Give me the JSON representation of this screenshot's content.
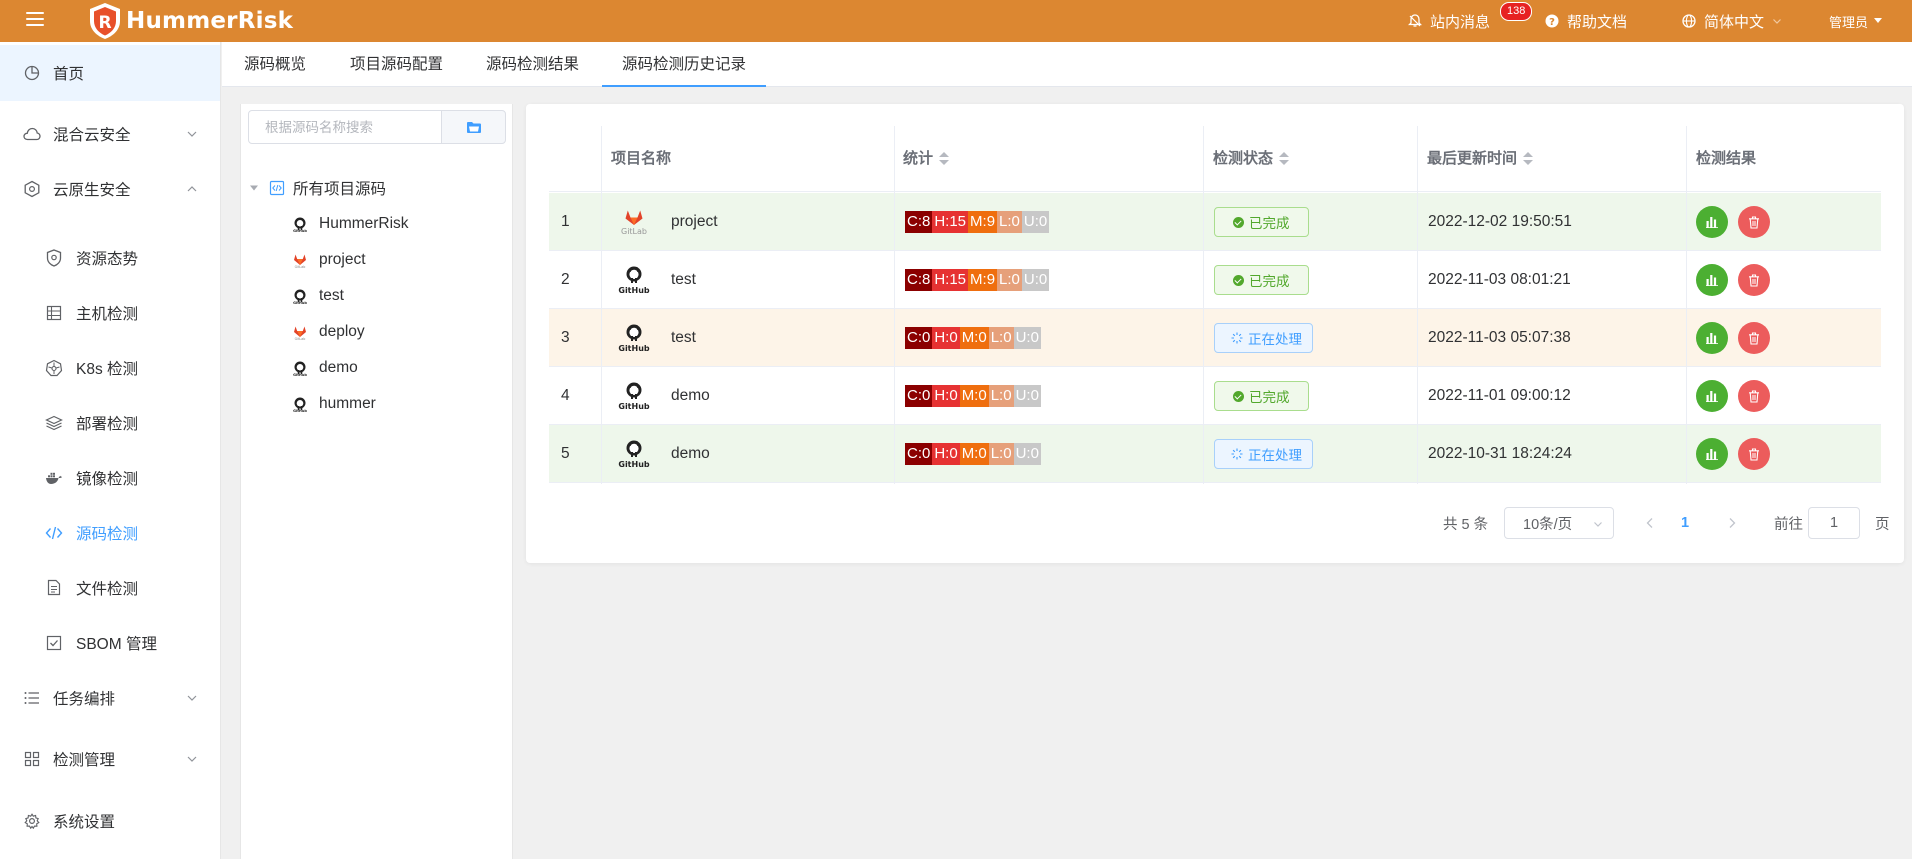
{
  "app": {
    "name": "HummerRisk",
    "brand_color": "#dc8731",
    "accent_color": "#409eff"
  },
  "header": {
    "messages_label": "站内消息",
    "messages_count": "138",
    "help_label": "帮助文档",
    "language_label": "简体中文",
    "user_label": "管理员"
  },
  "sidebar": {
    "home": "首页",
    "hybrid_cloud": "混合云安全",
    "cloud_native": "云原生安全",
    "sub": {
      "resource_posture": "资源态势",
      "host_check": "主机检测",
      "k8s_check": "K8s 检测",
      "deploy_check": "部署检测",
      "image_check": "镜像检测",
      "code_check": "源码检测",
      "file_check": "文件检测",
      "sbom": "SBOM 管理"
    },
    "task_orchestration": "任务编排",
    "check_management": "检测管理",
    "system_settings": "系统设置"
  },
  "tabs": [
    "源码概览",
    "项目源码配置",
    "源码检测结果",
    "源码检测历史记录"
  ],
  "tree": {
    "search_placeholder": "根据源码名称搜索",
    "root_label": "所有项目源码",
    "nodes": [
      {
        "label": "HummerRisk",
        "icon": "github-icon"
      },
      {
        "label": "project",
        "icon": "gitlab-icon"
      },
      {
        "label": "test",
        "icon": "github-icon"
      },
      {
        "label": "deploy",
        "icon": "gitlab-icon"
      },
      {
        "label": "demo",
        "icon": "github-icon"
      },
      {
        "label": "hummer",
        "icon": "github-icon"
      }
    ]
  },
  "table": {
    "headers": {
      "name": "项目名称",
      "stats": "统计",
      "status": "检测状态",
      "updated": "最后更新时间",
      "result": "检测结果"
    },
    "rows": [
      {
        "index": "1",
        "source": "GitLab",
        "name": "project",
        "c": "C:8",
        "h": "H:15",
        "m": "M:9",
        "l": "L:0",
        "u": "U:0",
        "status": "已完成",
        "updated": "2022-12-02 19:50:51"
      },
      {
        "index": "2",
        "source": "GitHub",
        "name": "test",
        "c": "C:8",
        "h": "H:15",
        "m": "M:9",
        "l": "L:0",
        "u": "U:0",
        "status": "已完成",
        "updated": "2022-11-03 08:01:21"
      },
      {
        "index": "3",
        "source": "GitHub",
        "name": "test",
        "c": "C:0",
        "h": "H:0",
        "m": "M:0",
        "l": "L:0",
        "u": "U:0",
        "status": "正在处理",
        "updated": "2022-11-03 05:07:38"
      },
      {
        "index": "4",
        "source": "GitHub",
        "name": "demo",
        "c": "C:0",
        "h": "H:0",
        "m": "M:0",
        "l": "L:0",
        "u": "U:0",
        "status": "已完成",
        "updated": "2022-11-01 09:00:12"
      },
      {
        "index": "5",
        "source": "GitHub",
        "name": "demo",
        "c": "C:0",
        "h": "H:0",
        "m": "M:0",
        "l": "L:0",
        "u": "U:0",
        "status": "正在处理",
        "updated": "2022-10-31 18:24:24"
      }
    ]
  },
  "pagination": {
    "total": "共 5 条",
    "page_size": "10条/页",
    "current_page": "1",
    "goto_prefix": "前往",
    "goto_value": "1",
    "goto_suffix": "页"
  }
}
